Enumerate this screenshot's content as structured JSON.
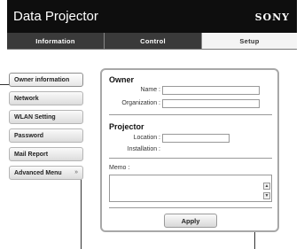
{
  "header": {
    "title": "Data Projector",
    "brand": "SONY"
  },
  "tabs": [
    {
      "label": "Information"
    },
    {
      "label": "Control"
    },
    {
      "label": "Setup"
    }
  ],
  "sidebar": {
    "items": [
      {
        "label": "Owner information"
      },
      {
        "label": "Network"
      },
      {
        "label": "WLAN Setting"
      },
      {
        "label": "Password"
      },
      {
        "label": "Mail Report"
      },
      {
        "label": "Advanced Menu",
        "arrow": "»"
      }
    ]
  },
  "owner": {
    "title": "Owner",
    "name_label": "Name :",
    "name_value": "",
    "org_label": "Organization :",
    "org_value": ""
  },
  "projector": {
    "title": "Projector",
    "location_label": "Location :",
    "location_value": "",
    "installation_label": "Installation :"
  },
  "memo": {
    "label": "Memo :",
    "value": ""
  },
  "apply_label": "Apply"
}
